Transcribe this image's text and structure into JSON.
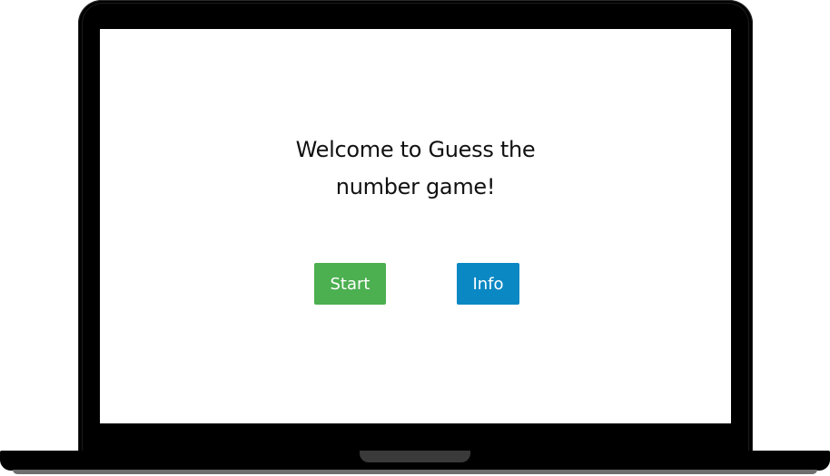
{
  "screen": {
    "title": "Welcome to Guess the number game!",
    "buttons": {
      "start_label": "Start",
      "info_label": "Info"
    }
  },
  "colors": {
    "start_button": "#4caf50",
    "info_button": "#0a88c4",
    "bezel": "#000000",
    "screen_background": "#ffffff"
  }
}
